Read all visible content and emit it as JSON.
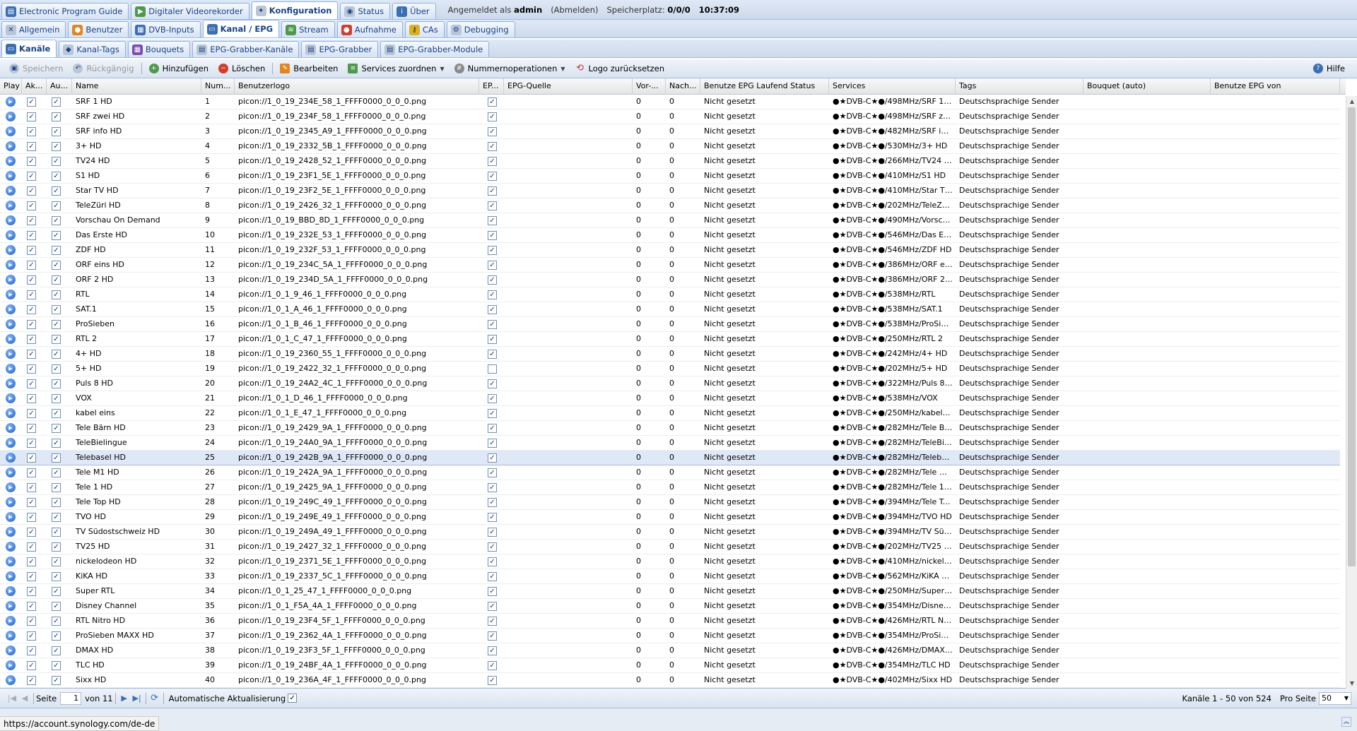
{
  "top_tabs": [
    {
      "label": "Electronic Program Guide",
      "icon": "epg-icon",
      "active": false
    },
    {
      "label": "Digitaler Videorekorder",
      "icon": "recorder-icon",
      "active": false
    },
    {
      "label": "Konfiguration",
      "icon": "wrench-icon",
      "active": true
    },
    {
      "label": "Status",
      "icon": "eye-icon",
      "active": false
    },
    {
      "label": "Über",
      "icon": "info-icon",
      "active": false
    }
  ],
  "header": {
    "logged_in_prefix": "Angemeldet als",
    "user": "admin",
    "logout": "(Abmelden)",
    "storage_label": "Speicherplatz:",
    "storage_value": "0/0/0",
    "time": "10:37:09"
  },
  "config_tabs": [
    {
      "label": "Allgemein",
      "icon": "tools-icon",
      "active": false
    },
    {
      "label": "Benutzer",
      "icon": "user-icon",
      "active": false
    },
    {
      "label": "DVB-Inputs",
      "icon": "dvb-icon",
      "active": false
    },
    {
      "label": "Kanal / EPG",
      "icon": "tv-icon",
      "active": true
    },
    {
      "label": "Stream",
      "icon": "stream-icon",
      "active": false
    },
    {
      "label": "Aufnahme",
      "icon": "record-icon",
      "active": false
    },
    {
      "label": "CAs",
      "icon": "key-icon",
      "active": false
    },
    {
      "label": "Debugging",
      "icon": "debug-icon",
      "active": false
    }
  ],
  "sub_tabs": [
    {
      "label": "Kanäle",
      "icon": "channel-icon",
      "active": true
    },
    {
      "label": "Kanal-Tags",
      "icon": "tag-icon",
      "active": false
    },
    {
      "label": "Bouquets",
      "icon": "bouquet-icon",
      "active": false
    },
    {
      "label": "EPG-Grabber-Kanäle",
      "icon": "grabber-channel-icon",
      "active": false
    },
    {
      "label": "EPG-Grabber",
      "icon": "grabber-icon",
      "active": false
    },
    {
      "label": "EPG-Grabber-Module",
      "icon": "grabber-module-icon",
      "active": false
    }
  ],
  "toolbar": {
    "save": "Speichern",
    "undo": "Rückgängig",
    "add": "Hinzufügen",
    "delete": "Löschen",
    "edit": "Bearbeiten",
    "map_services": "Services zuordnen",
    "number_ops": "Nummernoperationen",
    "reset_logo": "Logo zurücksetzen",
    "help": "Hilfe"
  },
  "columns": [
    "Play",
    "Ak...",
    "Au...",
    "Name",
    "Num...",
    "Benutzerlogo",
    "EP...",
    "EPG-Quelle",
    "Vor-...",
    "Nach...",
    "Benutze EPG Laufend Status",
    "Services",
    "Tags",
    "Bouquet (auto)",
    "Benutze EPG von"
  ],
  "rows": [
    {
      "name": "SRF 1 HD",
      "num": "1",
      "logo": "picon://1_0_19_234E_58_1_FFFF0000_0_0_0.png",
      "epg": true,
      "pre": "0",
      "post": "0",
      "status": "Nicht gesetzt",
      "service": "●★DVB-C★●/498MHz/SRF 1 HD",
      "tags": "Deutschsprachige Sender"
    },
    {
      "name": "SRF zwei HD",
      "num": "2",
      "logo": "picon://1_0_19_234F_58_1_FFFF0000_0_0_0.png",
      "epg": true,
      "pre": "0",
      "post": "0",
      "status": "Nicht gesetzt",
      "service": "●★DVB-C★●/498MHz/SRF zwei...",
      "tags": "Deutschsprachige Sender"
    },
    {
      "name": "SRF info HD",
      "num": "3",
      "logo": "picon://1_0_19_2345_A9_1_FFFF0000_0_0_0.png",
      "epg": true,
      "pre": "0",
      "post": "0",
      "status": "Nicht gesetzt",
      "service": "●★DVB-C★●/482MHz/SRF info HD",
      "tags": "Deutschsprachige Sender"
    },
    {
      "name": "3+ HD",
      "num": "4",
      "logo": "picon://1_0_19_2332_5B_1_FFFF0000_0_0_0.png",
      "epg": true,
      "pre": "0",
      "post": "0",
      "status": "Nicht gesetzt",
      "service": "●★DVB-C★●/530MHz/3+ HD",
      "tags": "Deutschsprachige Sender"
    },
    {
      "name": "TV24 HD",
      "num": "5",
      "logo": "picon://1_0_19_2428_52_1_FFFF0000_0_0_0.png",
      "epg": true,
      "pre": "0",
      "post": "0",
      "status": "Nicht gesetzt",
      "service": "●★DVB-C★●/266MHz/TV24 HD",
      "tags": "Deutschsprachige Sender"
    },
    {
      "name": "S1 HD",
      "num": "6",
      "logo": "picon://1_0_19_23F1_5E_1_FFFF0000_0_0_0.png",
      "epg": true,
      "pre": "0",
      "post": "0",
      "status": "Nicht gesetzt",
      "service": "●★DVB-C★●/410MHz/S1 HD",
      "tags": "Deutschsprachige Sender"
    },
    {
      "name": "Star TV HD",
      "num": "7",
      "logo": "picon://1_0_19_23F2_5E_1_FFFF0000_0_0_0.png",
      "epg": true,
      "pre": "0",
      "post": "0",
      "status": "Nicht gesetzt",
      "service": "●★DVB-C★●/410MHz/Star TV HD",
      "tags": "Deutschsprachige Sender"
    },
    {
      "name": "TeleZüri HD",
      "num": "8",
      "logo": "picon://1_0_19_2426_32_1_FFFF0000_0_0_0.png",
      "epg": true,
      "pre": "0",
      "post": "0",
      "status": "Nicht gesetzt",
      "service": "●★DVB-C★●/202MHz/TeleZüri HD",
      "tags": "Deutschsprachige Sender"
    },
    {
      "name": "Vorschau On Demand",
      "num": "9",
      "logo": "picon://1_0_19_BBD_8D_1_FFFF0000_0_0_0.png",
      "epg": true,
      "pre": "0",
      "post": "0",
      "status": "Nicht gesetzt",
      "service": "●★DVB-C★●/490MHz/Vorschau...",
      "tags": "Deutschsprachige Sender"
    },
    {
      "name": "Das Erste HD",
      "num": "10",
      "logo": "picon://1_0_19_232E_53_1_FFFF0000_0_0_0.png",
      "epg": true,
      "pre": "0",
      "post": "0",
      "status": "Nicht gesetzt",
      "service": "●★DVB-C★●/546MHz/Das Erste...",
      "tags": "Deutschsprachige Sender"
    },
    {
      "name": "ZDF HD",
      "num": "11",
      "logo": "picon://1_0_19_232F_53_1_FFFF0000_0_0_0.png",
      "epg": true,
      "pre": "0",
      "post": "0",
      "status": "Nicht gesetzt",
      "service": "●★DVB-C★●/546MHz/ZDF HD",
      "tags": "Deutschsprachige Sender"
    },
    {
      "name": "ORF eins HD",
      "num": "12",
      "logo": "picon://1_0_19_234C_5A_1_FFFF0000_0_0_0.png",
      "epg": true,
      "pre": "0",
      "post": "0",
      "status": "Nicht gesetzt",
      "service": "●★DVB-C★●/386MHz/ORF eins ...",
      "tags": "Deutschsprachige Sender"
    },
    {
      "name": "ORF 2 HD",
      "num": "13",
      "logo": "picon://1_0_19_234D_5A_1_FFFF0000_0_0_0.png",
      "epg": true,
      "pre": "0",
      "post": "0",
      "status": "Nicht gesetzt",
      "service": "●★DVB-C★●/386MHz/ORF 2 HD",
      "tags": "Deutschsprachige Sender"
    },
    {
      "name": "RTL",
      "num": "14",
      "logo": "picon://1_0_1_9_46_1_FFFF0000_0_0_0.png",
      "epg": true,
      "pre": "0",
      "post": "0",
      "status": "Nicht gesetzt",
      "service": "●★DVB-C★●/538MHz/RTL",
      "tags": "Deutschsprachige Sender"
    },
    {
      "name": "SAT.1",
      "num": "15",
      "logo": "picon://1_0_1_A_46_1_FFFF0000_0_0_0.png",
      "epg": true,
      "pre": "0",
      "post": "0",
      "status": "Nicht gesetzt",
      "service": "●★DVB-C★●/538MHz/SAT.1",
      "tags": "Deutschsprachige Sender"
    },
    {
      "name": "ProSieben",
      "num": "16",
      "logo": "picon://1_0_1_B_46_1_FFFF0000_0_0_0.png",
      "epg": true,
      "pre": "0",
      "post": "0",
      "status": "Nicht gesetzt",
      "service": "●★DVB-C★●/538MHz/ProSieben",
      "tags": "Deutschsprachige Sender"
    },
    {
      "name": "RTL 2",
      "num": "17",
      "logo": "picon://1_0_1_C_47_1_FFFF0000_0_0_0.png",
      "epg": true,
      "pre": "0",
      "post": "0",
      "status": "Nicht gesetzt",
      "service": "●★DVB-C★●/250MHz/RTL 2",
      "tags": "Deutschsprachige Sender"
    },
    {
      "name": "4+ HD",
      "num": "18",
      "logo": "picon://1_0_19_2360_55_1_FFFF0000_0_0_0.png",
      "epg": true,
      "pre": "0",
      "post": "0",
      "status": "Nicht gesetzt",
      "service": "●★DVB-C★●/242MHz/4+ HD",
      "tags": "Deutschsprachige Sender"
    },
    {
      "name": "5+ HD",
      "num": "19",
      "logo": "picon://1_0_19_2422_32_1_FFFF0000_0_0_0.png",
      "epg": false,
      "pre": "0",
      "post": "0",
      "status": "Nicht gesetzt",
      "service": "●★DVB-C★●/202MHz/5+ HD",
      "tags": "Deutschsprachige Sender"
    },
    {
      "name": "Puls 8 HD",
      "num": "20",
      "logo": "picon://1_0_19_24A2_4C_1_FFFF0000_0_0_0.png",
      "epg": true,
      "pre": "0",
      "post": "0",
      "status": "Nicht gesetzt",
      "service": "●★DVB-C★●/322MHz/Puls 8 HD",
      "tags": "Deutschsprachige Sender"
    },
    {
      "name": "VOX",
      "num": "21",
      "logo": "picon://1_0_1_D_46_1_FFFF0000_0_0_0.png",
      "epg": true,
      "pre": "0",
      "post": "0",
      "status": "Nicht gesetzt",
      "service": "●★DVB-C★●/538MHz/VOX",
      "tags": "Deutschsprachige Sender"
    },
    {
      "name": "kabel eins",
      "num": "22",
      "logo": "picon://1_0_1_E_47_1_FFFF0000_0_0_0.png",
      "epg": true,
      "pre": "0",
      "post": "0",
      "status": "Nicht gesetzt",
      "service": "●★DVB-C★●/250MHz/kabel eins",
      "tags": "Deutschsprachige Sender"
    },
    {
      "name": "Tele Bärn HD",
      "num": "23",
      "logo": "picon://1_0_19_2429_9A_1_FFFF0000_0_0_0.png",
      "epg": true,
      "pre": "0",
      "post": "0",
      "status": "Nicht gesetzt",
      "service": "●★DVB-C★●/282MHz/Tele Bärn ...",
      "tags": "Deutschsprachige Sender"
    },
    {
      "name": "TeleBielingue",
      "num": "24",
      "logo": "picon://1_0_19_24A0_9A_1_FFFF0000_0_0_0.png",
      "epg": true,
      "pre": "0",
      "post": "0",
      "status": "Nicht gesetzt",
      "service": "●★DVB-C★●/282MHz/TeleBielin...",
      "tags": "Deutschsprachige Sender"
    },
    {
      "name": "Telebasel HD",
      "num": "25",
      "logo": "picon://1_0_19_242B_9A_1_FFFF0000_0_0_0.png",
      "epg": true,
      "pre": "0",
      "post": "0",
      "status": "Nicht gesetzt",
      "service": "●★DVB-C★●/282MHz/Telebasel ...",
      "tags": "Deutschsprachige Sender",
      "selected": true
    },
    {
      "name": "Tele M1 HD",
      "num": "26",
      "logo": "picon://1_0_19_242A_9A_1_FFFF0000_0_0_0.png",
      "epg": true,
      "pre": "0",
      "post": "0",
      "status": "Nicht gesetzt",
      "service": "●★DVB-C★●/282MHz/Tele M1 HD",
      "tags": "Deutschsprachige Sender"
    },
    {
      "name": "Tele 1 HD",
      "num": "27",
      "logo": "picon://1_0_19_2425_9A_1_FFFF0000_0_0_0.png",
      "epg": true,
      "pre": "0",
      "post": "0",
      "status": "Nicht gesetzt",
      "service": "●★DVB-C★●/282MHz/Tele 1 HD",
      "tags": "Deutschsprachige Sender"
    },
    {
      "name": "Tele Top HD",
      "num": "28",
      "logo": "picon://1_0_19_249C_49_1_FFFF0000_0_0_0.png",
      "epg": true,
      "pre": "0",
      "post": "0",
      "status": "Nicht gesetzt",
      "service": "●★DVB-C★●/394MHz/Tele Top HD",
      "tags": "Deutschsprachige Sender"
    },
    {
      "name": "TVO HD",
      "num": "29",
      "logo": "picon://1_0_19_249E_49_1_FFFF0000_0_0_0.png",
      "epg": true,
      "pre": "0",
      "post": "0",
      "status": "Nicht gesetzt",
      "service": "●★DVB-C★●/394MHz/TVO HD",
      "tags": "Deutschsprachige Sender"
    },
    {
      "name": "TV Südostschweiz HD",
      "num": "30",
      "logo": "picon://1_0_19_249A_49_1_FFFF0000_0_0_0.png",
      "epg": true,
      "pre": "0",
      "post": "0",
      "status": "Nicht gesetzt",
      "service": "●★DVB-C★●/394MHz/TV Südos...",
      "tags": "Deutschsprachige Sender"
    },
    {
      "name": "TV25 HD",
      "num": "31",
      "logo": "picon://1_0_19_2427_32_1_FFFF0000_0_0_0.png",
      "epg": true,
      "pre": "0",
      "post": "0",
      "status": "Nicht gesetzt",
      "service": "●★DVB-C★●/202MHz/TV25 HD",
      "tags": "Deutschsprachige Sender"
    },
    {
      "name": "nickelodeon HD",
      "num": "32",
      "logo": "picon://1_0_19_2371_5E_1_FFFF0000_0_0_0.png",
      "epg": true,
      "pre": "0",
      "post": "0",
      "status": "Nicht gesetzt",
      "service": "●★DVB-C★●/410MHz/nickelode...",
      "tags": "Deutschsprachige Sender"
    },
    {
      "name": "KiKA HD",
      "num": "33",
      "logo": "picon://1_0_19_2337_5C_1_FFFF0000_0_0_0.png",
      "epg": true,
      "pre": "0",
      "post": "0",
      "status": "Nicht gesetzt",
      "service": "●★DVB-C★●/562MHz/KiKA HD",
      "tags": "Deutschsprachige Sender"
    },
    {
      "name": "Super RTL",
      "num": "34",
      "logo": "picon://1_0_1_25_47_1_FFFF0000_0_0_0.png",
      "epg": true,
      "pre": "0",
      "post": "0",
      "status": "Nicht gesetzt",
      "service": "●★DVB-C★●/250MHz/Super RTL",
      "tags": "Deutschsprachige Sender"
    },
    {
      "name": "Disney Channel",
      "num": "35",
      "logo": "picon://1_0_1_F5A_4A_1_FFFF0000_0_0_0.png",
      "epg": true,
      "pre": "0",
      "post": "0",
      "status": "Nicht gesetzt",
      "service": "●★DVB-C★●/354MHz/Disney Ch...",
      "tags": "Deutschsprachige Sender"
    },
    {
      "name": "RTL Nitro HD",
      "num": "36",
      "logo": "picon://1_0_19_23F4_5F_1_FFFF0000_0_0_0.png",
      "epg": true,
      "pre": "0",
      "post": "0",
      "status": "Nicht gesetzt",
      "service": "●★DVB-C★●/426MHz/RTL Nitro ...",
      "tags": "Deutschsprachige Sender"
    },
    {
      "name": "ProSieben MAXX HD",
      "num": "37",
      "logo": "picon://1_0_19_2362_4A_1_FFFF0000_0_0_0.png",
      "epg": true,
      "pre": "0",
      "post": "0",
      "status": "Nicht gesetzt",
      "service": "●★DVB-C★●/354MHz/ProSieben...",
      "tags": "Deutschsprachige Sender"
    },
    {
      "name": "DMAX HD",
      "num": "38",
      "logo": "picon://1_0_19_23F3_5F_1_FFFF0000_0_0_0.png",
      "epg": true,
      "pre": "0",
      "post": "0",
      "status": "Nicht gesetzt",
      "service": "●★DVB-C★●/426MHz/DMAX HD",
      "tags": "Deutschsprachige Sender"
    },
    {
      "name": "TLC HD",
      "num": "39",
      "logo": "picon://1_0_19_24BF_4A_1_FFFF0000_0_0_0.png",
      "epg": true,
      "pre": "0",
      "post": "0",
      "status": "Nicht gesetzt",
      "service": "●★DVB-C★●/354MHz/TLC HD",
      "tags": "Deutschsprachige Sender"
    },
    {
      "name": "Sixx HD",
      "num": "40",
      "logo": "picon://1_0_19_236A_4F_1_FFFF0000_0_0_0.png",
      "epg": true,
      "pre": "0",
      "post": "0",
      "status": "Nicht gesetzt",
      "service": "●★DVB-C★●/402MHz/Sixx HD",
      "tags": "Deutschsprachige Sender"
    }
  ],
  "pager": {
    "page_label": "Seite",
    "page": "1",
    "of_label": "von 11",
    "auto_refresh": "Automatische Aktualisierung",
    "summary": "Kanäle 1 - 50 von 524",
    "per_page_label": "Pro Seite",
    "per_page": "50"
  },
  "status_url": "https://account.synology.com/de-de"
}
